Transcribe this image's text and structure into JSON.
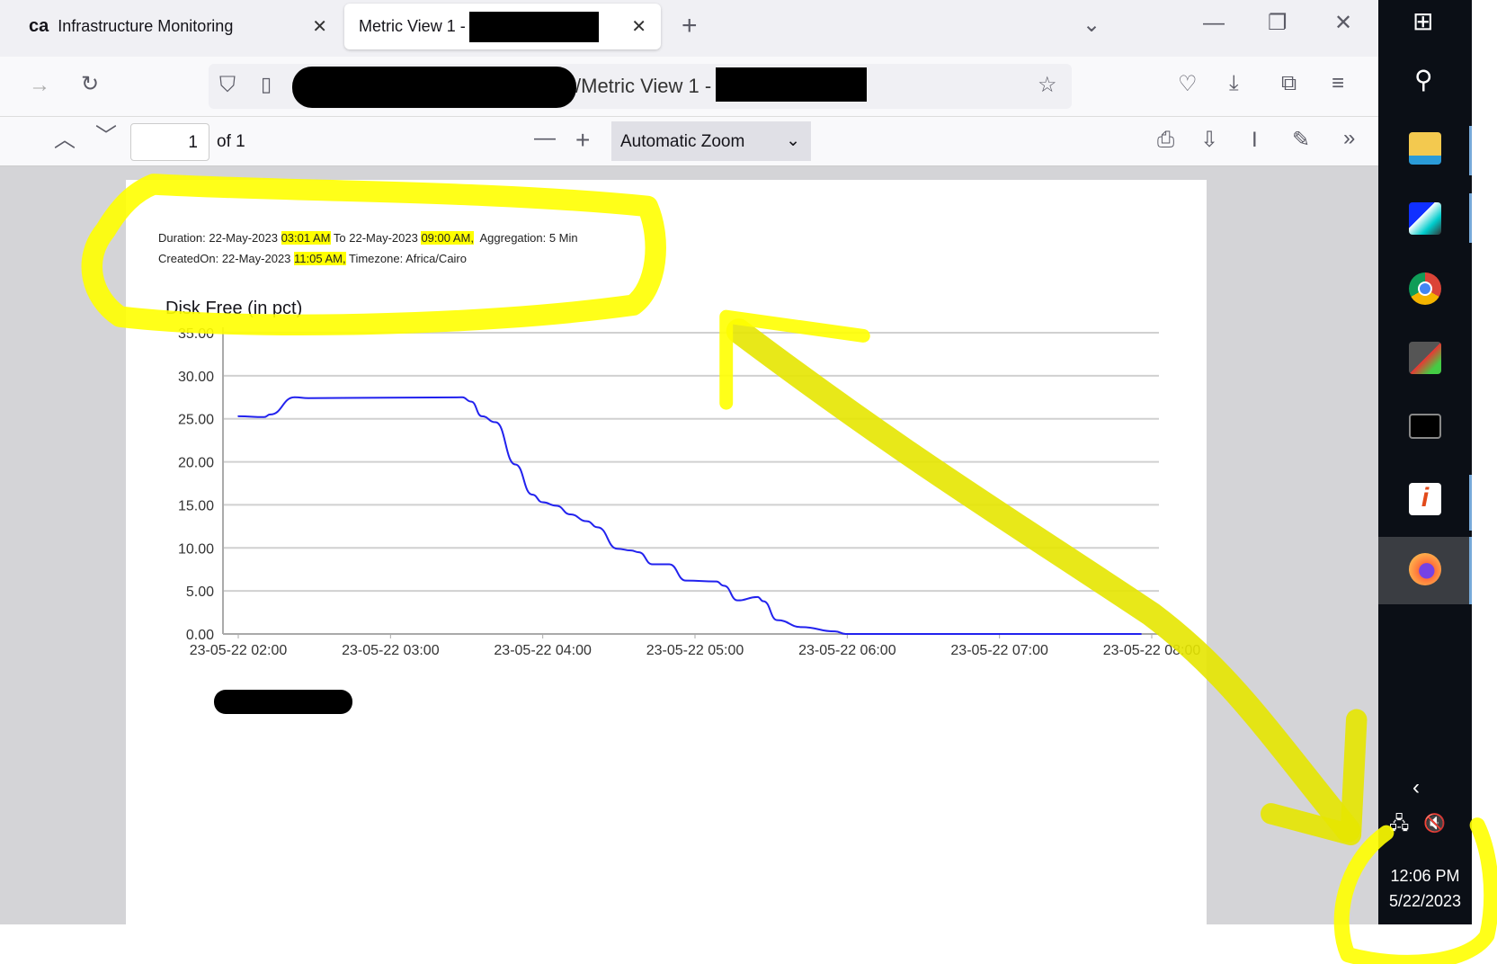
{
  "browser": {
    "tabs": [
      {
        "label": "Infrastructure Monitoring",
        "logo": "ca",
        "active": false
      },
      {
        "label": "Metric View 1 -",
        "active": true
      }
    ],
    "url_text": "/Metric View 1 -",
    "new_tab": "+"
  },
  "pdf_toolbar": {
    "page_number": "1",
    "page_total": "of 1",
    "zoom": "Automatic Zoom"
  },
  "document": {
    "duration_prefix": "Duration: 22-May-2023 ",
    "duration_start": "03:01 AM",
    "duration_mid": " To 22-May-2023 ",
    "duration_end": "09:00 AM,",
    "aggregation": "  Aggregation: 5 Min",
    "created_prefix": "CreatedOn: 22-May-2023 ",
    "created_time": "11:05 AM,",
    "timezone": " Timezone: Africa/Cairo"
  },
  "chart_data": {
    "type": "line",
    "title": "Disk Free (in pct)",
    "xlabel": "",
    "ylabel": "",
    "ylim": [
      0,
      35
    ],
    "yticks": [
      "0.00",
      "5.00",
      "10.00",
      "15.00",
      "20.00",
      "25.00",
      "30.00",
      "35.00"
    ],
    "xticks": [
      "23-05-22 02:00",
      "23-05-22 03:00",
      "23-05-22 04:00",
      "23-05-22 05:00",
      "23-05-22 06:00",
      "23-05-22 07:00",
      "23-05-22 08:00"
    ],
    "xlim_hours_from_0200": [
      0,
      6
    ],
    "grid": true,
    "series": [
      {
        "name": "Disk Free",
        "color": "#2222ee",
        "x_hours_from_0200": [
          0,
          0.17,
          0.21,
          0.37,
          0.46,
          1.47,
          1.53,
          1.6,
          1.69,
          1.82,
          1.93,
          2.0,
          2.09,
          2.18,
          2.29,
          2.36,
          2.49,
          2.58,
          2.63,
          2.72,
          2.83,
          2.94,
          3.14,
          3.19,
          3.28,
          3.41,
          3.45,
          3.54,
          3.7,
          3.92,
          3.99,
          5.93
        ],
        "values": [
          25.3,
          25.2,
          25.5,
          27.5,
          27.4,
          27.5,
          27.0,
          25.3,
          24.6,
          19.7,
          16.2,
          15.3,
          14.9,
          13.9,
          13.1,
          12.4,
          9.9,
          9.7,
          9.5,
          8.1,
          8.1,
          6.2,
          6.1,
          5.6,
          3.9,
          4.3,
          3.8,
          1.6,
          0.8,
          0.3,
          0.0,
          0.0
        ]
      }
    ]
  },
  "taskbar": {
    "time": "12:06 PM",
    "date": "5/22/2023"
  },
  "colors": {
    "highlight": "#ffff00",
    "line": "#2222ee"
  }
}
